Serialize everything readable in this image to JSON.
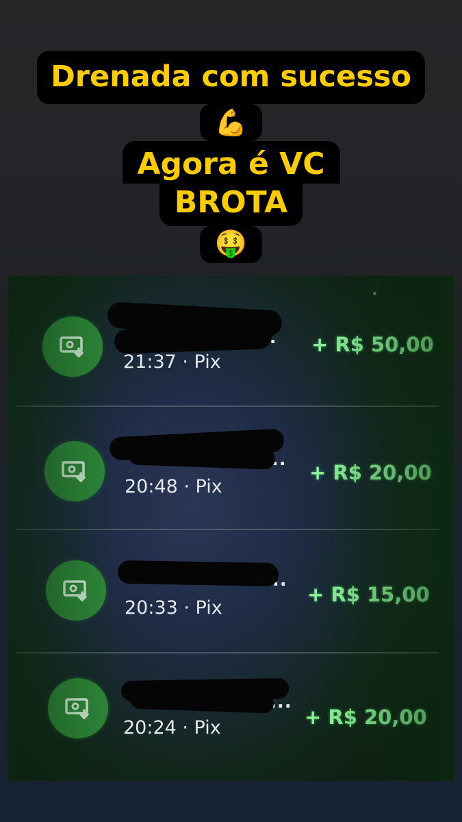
{
  "caption": {
    "line1": "Drenada com sucesso",
    "emoji1": "💪",
    "line2": "Agora é VC",
    "line3": "BROTA",
    "emoji2": "🤑"
  },
  "transactions": [
    {
      "name": "...",
      "time": "21:37",
      "method": "Pix",
      "sub": "21:37 · Pix",
      "amount": "+ R$ 50,00",
      "icon": "money-receive-icon"
    },
    {
      "name": "...",
      "time": "20:48",
      "method": "Pix",
      "sub": "20:48 · Pix",
      "amount": "+ R$ 20,00",
      "icon": "money-receive-icon"
    },
    {
      "name": "...",
      "time": "20:33",
      "method": "Pix",
      "sub": "20:33 · Pix",
      "amount": "+ R$ 15,00",
      "icon": "money-receive-icon"
    },
    {
      "name": "...",
      "time": "20:24",
      "method": "Pix",
      "sub": "20:24 · Pix",
      "amount": "+ R$ 20,00",
      "icon": "money-receive-icon"
    }
  ],
  "colors": {
    "caption_text": "#ffcc00",
    "caption_bg": "#000000",
    "icon_bg": "#2f8a3a",
    "amount": "#8cf29a"
  }
}
